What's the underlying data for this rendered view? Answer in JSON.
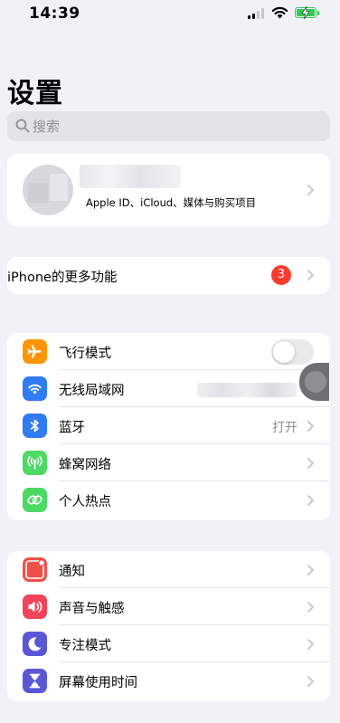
{
  "status_bar": {
    "time": "14:39",
    "battery_color": "#34c759"
  },
  "page": {
    "title": "设置"
  },
  "search": {
    "placeholder": "搜索"
  },
  "profile": {
    "subtitle": "Apple ID、iCloud、媒体与购买项目"
  },
  "more_features": {
    "label": "iPhone的更多功能",
    "badge": "3"
  },
  "connectivity": [
    {
      "label": "飞行模式",
      "icon": "airplane-icon",
      "color": "#ff9500",
      "toggle": false
    },
    {
      "label": "无线局域网",
      "icon": "wifi-icon",
      "color": "#2f7cf6"
    },
    {
      "label": "蓝牙",
      "icon": "bluetooth-icon",
      "color": "#2f7cf6",
      "value": "打开"
    },
    {
      "label": "蜂窝网络",
      "icon": "cellular-icon",
      "color": "#4cd964"
    },
    {
      "label": "个人热点",
      "icon": "hotspot-icon",
      "color": "#4cd964"
    }
  ],
  "system": [
    {
      "label": "通知",
      "icon": "bell-icon",
      "color": "#f0504a"
    },
    {
      "label": "声音与触感",
      "icon": "speaker-icon",
      "color": "#f0445d"
    },
    {
      "label": "专注模式",
      "icon": "moon-icon",
      "color": "#5b56d6"
    },
    {
      "label": "屏幕使用时间",
      "icon": "hourglass-icon",
      "color": "#5b56d6"
    }
  ]
}
